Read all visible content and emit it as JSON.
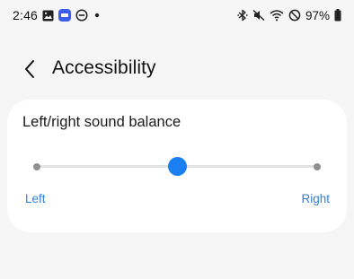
{
  "status_bar": {
    "time": "2:46",
    "battery_percent": "97%",
    "left_icons": [
      "gallery-icon",
      "app-notification-icon",
      "do-not-disturb-icon",
      "dot-icon"
    ],
    "right_icons": [
      "bluetooth-icon",
      "mute-icon",
      "wifi-icon",
      "blocked-icon",
      "battery-icon"
    ]
  },
  "header": {
    "title": "Accessibility",
    "back_icon": "chevron-left-icon"
  },
  "balance_card": {
    "title": "Left/right sound balance",
    "left_label": "Left",
    "right_label": "Right",
    "slider_value": 0.5
  },
  "colors": {
    "background": "#f5f5f5",
    "card": "#ffffff",
    "accent": "#1a7ff2",
    "label_blue": "#2f7fd8"
  }
}
